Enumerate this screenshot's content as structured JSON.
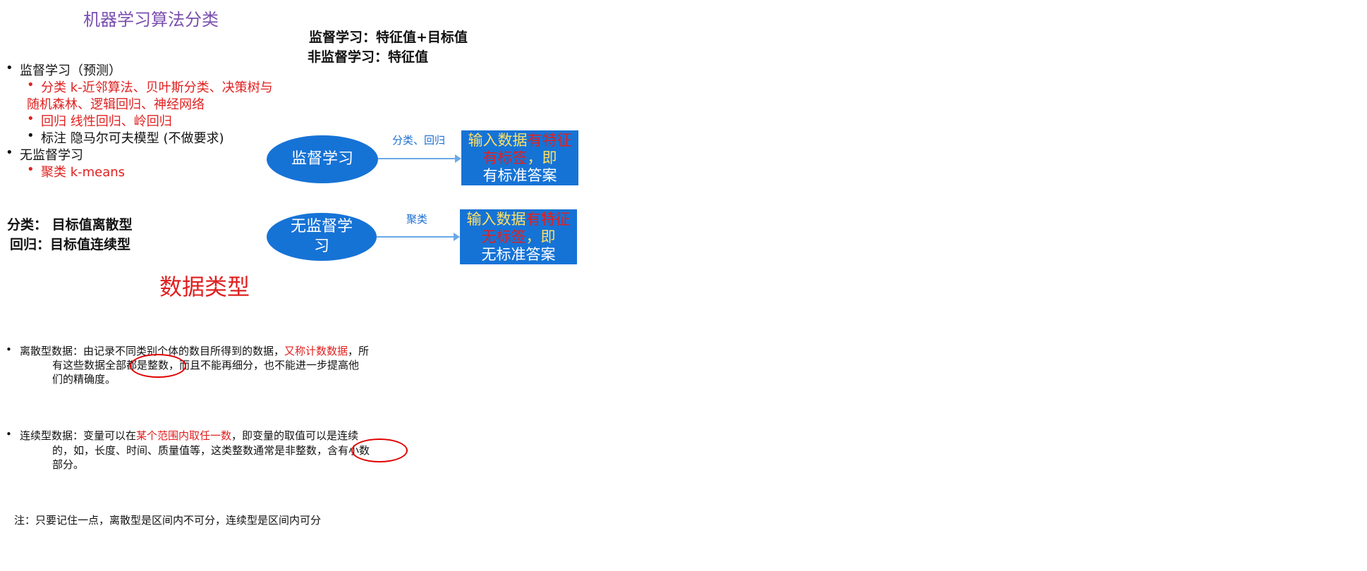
{
  "title": "机器学习算法分类",
  "top_right": {
    "supervised_def": "监督学习：特征值+目标值",
    "unsupervised_def": "非监督学习：特征值"
  },
  "list": {
    "supervised_header": "监督学习（预测）",
    "classification_line1": "分类   k-近邻算法、贝叶斯分类、决策树与",
    "classification_line2": "随机森林、逻辑回归、神经网络",
    "regression": "回归   线性回归、岭回归",
    "labeling": "标注   隐马尔可夫模型   (不做要求)",
    "unsupervised_header": "无监督学习",
    "clustering": "聚类   k-means"
  },
  "diagram": {
    "supervised_node": "监督学习",
    "supervised_edge": "分类、回归",
    "supervised_box": {
      "yellow_part": "输入数据",
      "red_part": "有特征有标签",
      "comma": "，即",
      "last_line": "有标准答案"
    },
    "unsupervised_node": "无监督学习",
    "unsupervised_edge": "聚类",
    "unsupervised_box": {
      "yellow_part": "输入数据",
      "red_part": "有特征无标签",
      "comma": "，即",
      "last_line": "无标准答案"
    }
  },
  "definitions": {
    "classification": "分类： 目标值离散型",
    "regression": "回归：目标值连续型"
  },
  "data_types": {
    "heading": "数据类型",
    "discrete": {
      "prefix": "离散型数据：由记录不同类别个体的数目所得到的数据，",
      "highlight": "又称计数数据",
      "suffix": "，所",
      "line2_a": "有这些数据全部",
      "circled": "都是整数",
      "line2_b": "，而且不能再细分，也不能进一步提高他",
      "line3": "们的精确度。"
    },
    "continuous": {
      "prefix": "连续型数据：变量可以在",
      "highlight": "某个范围内取任一数",
      "suffix": "，即变量的取值可以是连续",
      "line2_a": "的，如，长度、时间、质量值等，这类整数通常是非整数，",
      "circled": "含有小数",
      "line3": "部分。"
    },
    "note": "注：只要记住一点，离散型是区间内不可分，连续型是区间内可分"
  },
  "colors": {
    "accent_blue": "#1673d6",
    "red": "#e02020",
    "purple": "#7b4fb0",
    "yellow": "#ffe066"
  }
}
